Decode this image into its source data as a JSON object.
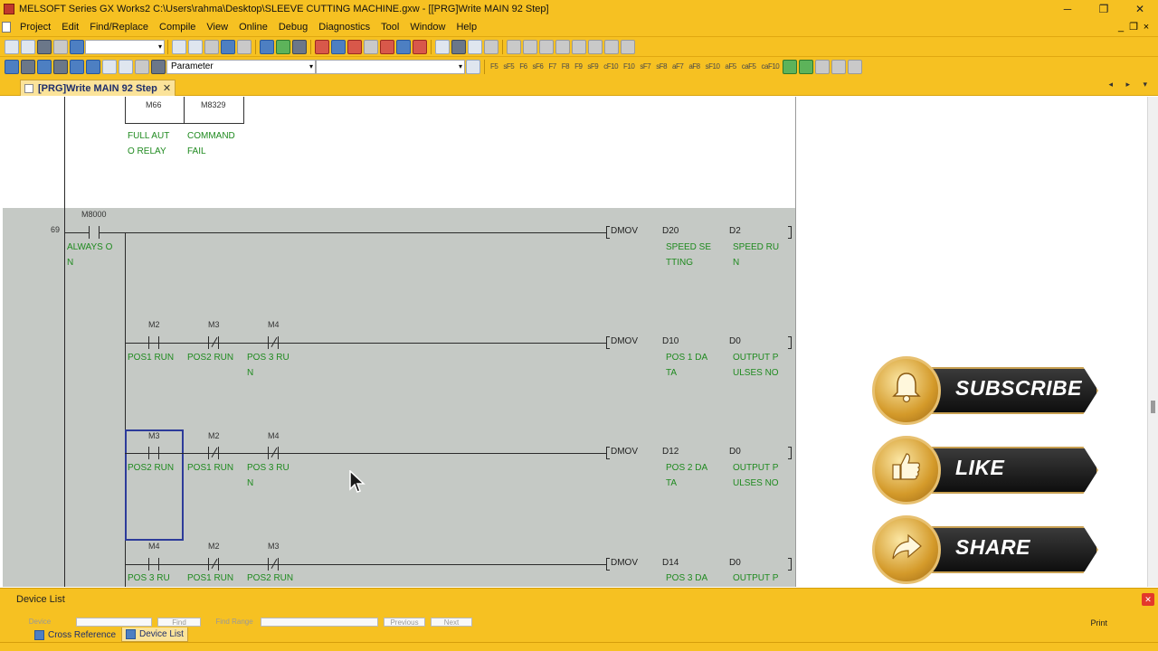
{
  "window": {
    "title": "MELSOFT Series GX Works2 C:\\Users\\rahma\\Desktop\\SLEEVE CUTTING MACHINE.gxw - [[PRG]Write MAIN 92 Step]",
    "minimize": "─",
    "restore": "❐",
    "close": "✕"
  },
  "menubar": {
    "items": [
      "Project",
      "Edit",
      "Find/Replace",
      "Compile",
      "View",
      "Online",
      "Debug",
      "Diagnostics",
      "Tool",
      "Window",
      "Help"
    ],
    "mdi_min": "_",
    "mdi_restore": "❐",
    "mdi_close": "×"
  },
  "toolbar": {
    "parameter_combo": "Parameter",
    "combo_arrow": "▾",
    "fkeys": [
      "F5",
      "sF5",
      "F6",
      "sF6",
      "F7",
      "F8",
      "F9",
      "sF9",
      "cF10",
      "F10",
      "sF7",
      "sF8",
      "aF7",
      "aF8",
      "sF10",
      "aF5",
      "caF5",
      "caF10"
    ]
  },
  "tab": {
    "label": "[PRG]Write MAIN 92 Step",
    "close": "✕",
    "nav": "◂ ▸ ▾"
  },
  "ladder": {
    "rung_top": {
      "contacts": [
        {
          "device": "M66",
          "comment_1": "FULL AUT",
          "comment_2": "O RELAY"
        },
        {
          "device": "M8329",
          "comment_1": "COMMAND",
          "comment_2": "FAIL"
        }
      ]
    },
    "step_69": {
      "step": "69",
      "contact": {
        "device": "M8000",
        "comment_1": "ALWAYS O",
        "comment_2": "N"
      },
      "instr": "DMOV",
      "op1": {
        "device": "D20",
        "comment_1": "SPEED SE",
        "comment_2": "TTING"
      },
      "op2": {
        "device": "D2",
        "comment_1": "SPEED RU",
        "comment_2": "N"
      }
    },
    "rung_b": {
      "contacts": [
        {
          "device": "M2",
          "comment_1": "POS1 RUN",
          "comment_2": ""
        },
        {
          "device": "M3",
          "comment_1": "POS2 RUN",
          "comment_2": ""
        },
        {
          "device": "M4",
          "comment_1": "POS 3 RU",
          "comment_2": "N"
        }
      ],
      "instr": "DMOV",
      "op1": {
        "device": "D10",
        "comment_1": "POS 1 DA",
        "comment_2": "TA"
      },
      "op2": {
        "device": "D0",
        "comment_1": "OUTPUT P",
        "comment_2": "ULSES NO"
      }
    },
    "rung_c": {
      "contacts": [
        {
          "device": "M3",
          "comment_1": "POS2 RUN",
          "comment_2": ""
        },
        {
          "device": "M2",
          "comment_1": "POS1 RUN",
          "comment_2": ""
        },
        {
          "device": "M4",
          "comment_1": "POS 3 RU",
          "comment_2": "N"
        }
      ],
      "instr": "DMOV",
      "op1": {
        "device": "D12",
        "comment_1": "POS 2 DA",
        "comment_2": "TA"
      },
      "op2": {
        "device": "D0",
        "comment_1": "OUTPUT P",
        "comment_2": "ULSES NO"
      }
    },
    "rung_d": {
      "contacts": [
        {
          "device": "M4",
          "comment_1": "POS 3 RU"
        },
        {
          "device": "M2",
          "comment_1": "POS1 RUN"
        },
        {
          "device": "M3",
          "comment_1": "POS2 RUN"
        }
      ],
      "instr": "DMOV",
      "op1": {
        "device": "D14",
        "comment_1": "POS 3 DA"
      },
      "op2": {
        "device": "D0",
        "comment_1": "OUTPUT P"
      }
    }
  },
  "overlay": {
    "subscribe": "SUBSCRIBE",
    "like": "LIKE",
    "share": "SHARE"
  },
  "device_list": {
    "title": "Device List",
    "close": "✕",
    "fields": [
      "Device",
      "",
      "Find",
      "Find Range",
      "",
      "Previous",
      "Next"
    ],
    "print": "Print"
  },
  "bottom_tabs": [
    "Cross Reference",
    "Device List"
  ]
}
